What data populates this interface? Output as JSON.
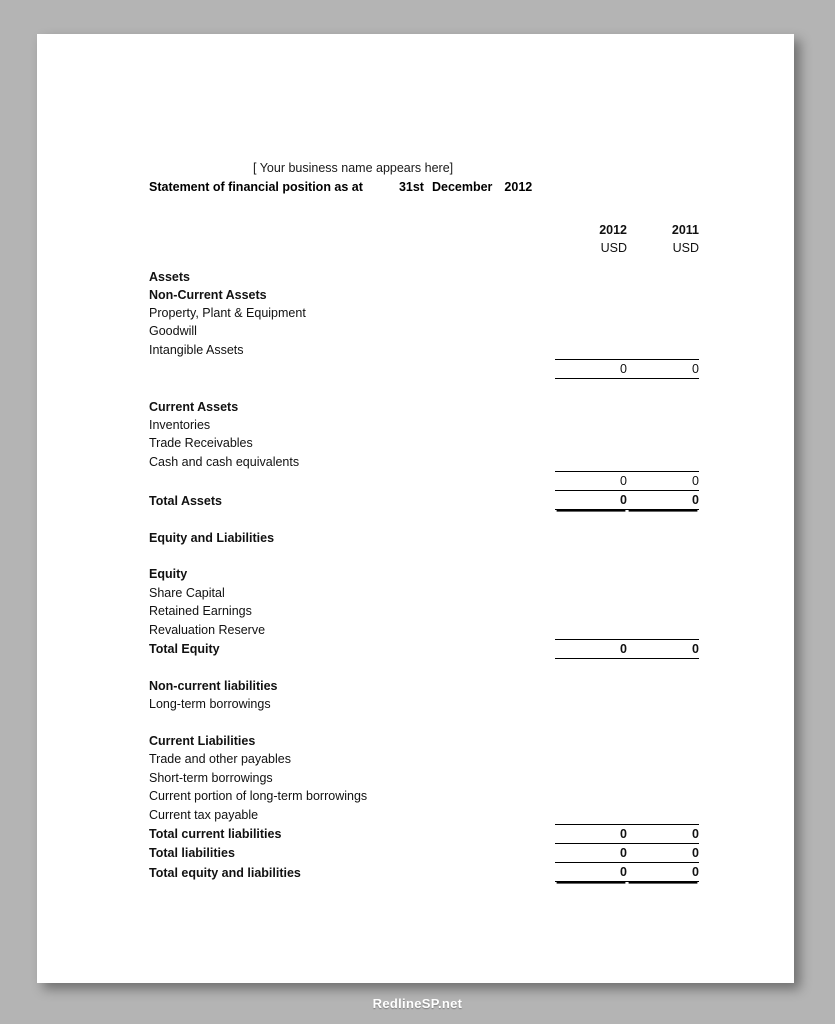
{
  "document": {
    "business_name": "[ Your business name appears here]",
    "title": "Statement of financial position as at",
    "date_day": "31st",
    "date_month": "December",
    "date_year": "2012"
  },
  "columns": {
    "year_current": "2012",
    "year_prior": "2011",
    "currency_current": "USD",
    "currency_prior": "USD"
  },
  "rows": {
    "assets_heading": "Assets",
    "non_current_assets_heading": "Non-Current Assets",
    "ppe": "Property, Plant & Equipment",
    "goodwill": "Goodwill",
    "intangible_assets": "Intangible Assets",
    "non_current_assets_total_current": "0",
    "non_current_assets_total_prior": "0",
    "current_assets_heading": "Current Assets",
    "inventories": "Inventories",
    "trade_receivables": "Trade Receivables",
    "cash_and_equivalents": "Cash and cash equivalents",
    "current_assets_total_current": "0",
    "current_assets_total_prior": "0",
    "total_assets": "Total Assets",
    "total_assets_current": "0",
    "total_assets_prior": "0",
    "equity_and_liabilities_heading": "Equity and Liabilities",
    "equity_heading": "Equity",
    "share_capital": "Share Capital",
    "retained_earnings": "Retained Earnings",
    "revaluation_reserve": "Revaluation Reserve",
    "total_equity": "Total Equity",
    "total_equity_current": "0",
    "total_equity_prior": "0",
    "non_current_liabilities_heading": "Non-current liabilities",
    "long_term_borrowings": "Long-term borrowings",
    "current_liabilities_heading": "Current Liabilities",
    "trade_and_other_payables": "Trade and other payables",
    "short_term_borrowings": "Short-term borrowings",
    "current_portion_long_term": "Current portion of long-term borrowings",
    "current_tax_payable": "Current tax payable",
    "total_current_liabilities": "Total current liabilities",
    "total_current_liabilities_current": "0",
    "total_current_liabilities_prior": "0",
    "total_liabilities": "Total liabilities",
    "total_liabilities_current": "0",
    "total_liabilities_prior": "0",
    "total_equity_and_liabilities": "Total equity and liabilities",
    "total_equity_and_liabilities_current": "0",
    "total_equity_and_liabilities_prior": "0"
  },
  "footer": {
    "watermark": "RedlineSP.net"
  },
  "colors": {
    "background": "#b4b4b4",
    "page": "#ffffff",
    "text": "#111111",
    "rule": "#000000",
    "watermark_text": "#ffffff"
  }
}
